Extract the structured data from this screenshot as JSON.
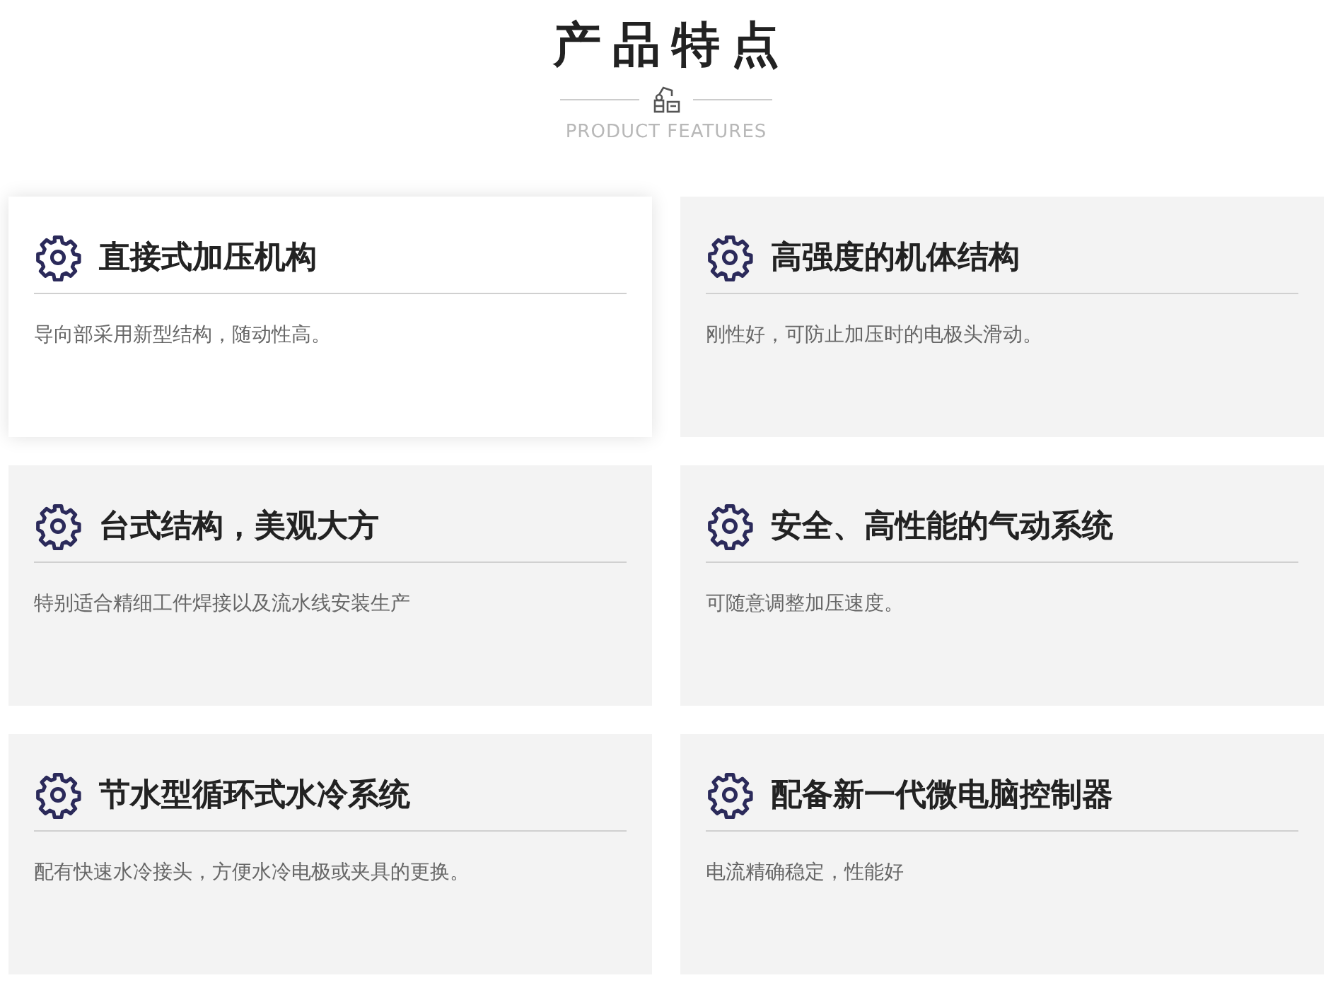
{
  "header": {
    "title": "产品特点",
    "subtitle": "PRODUCT FEATURES"
  },
  "features": [
    {
      "title": "直接式加压机构",
      "description": "导向部采用新型结构，随动性高。",
      "highlighted": true
    },
    {
      "title": "高强度的机体结构",
      "description": "刚性好，可防止加压时的电极头滑动。",
      "highlighted": false
    },
    {
      "title": "台式结构，美观大方",
      "description": "特别适合精细工件焊接以及流水线安装生产",
      "highlighted": false
    },
    {
      "title": "安全、高性能的气动系统",
      "description": "可随意调整加压速度。",
      "highlighted": false
    },
    {
      "title": "节水型循环式水冷系统",
      "description": "配有快速水冷接头，方便水冷电极或夹具的更换。",
      "highlighted": false
    },
    {
      "title": "配备新一代微电脑控制器",
      "description": "电流精确稳定，性能好",
      "highlighted": false
    }
  ]
}
